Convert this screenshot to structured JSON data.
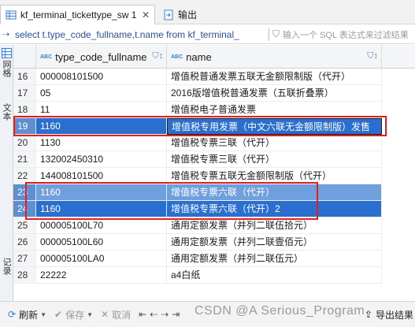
{
  "tabs": [
    {
      "label": "kf_terminal_tickettype_sw 1",
      "close": "✕",
      "active": true
    },
    {
      "label": "输出",
      "active": false
    }
  ],
  "query": {
    "sql": "select t.type_code_fullname,t.name from kf_terminal_",
    "filter_placeholder": "输入一个 SQL 表达式来过滤结果"
  },
  "side_tabs": [
    "网格",
    "文本",
    "记录"
  ],
  "columns": [
    {
      "type_tag": "ABC",
      "name": "type_code_fullname"
    },
    {
      "type_tag": "ABC",
      "name": "name"
    }
  ],
  "rows": [
    {
      "n": "16",
      "code": "000008101500",
      "name": "增值税普通发票五联无金额限制版（代开）"
    },
    {
      "n": "17",
      "code": "05",
      "name": "2016版增值税普通发票（五联折叠票）"
    },
    {
      "n": "18",
      "code": "11",
      "name": "增值税电子普通发票"
    },
    {
      "n": "19",
      "code": "1160",
      "name": "增值税专用发票（中文六联无金额限制版）发售",
      "selected": true,
      "focus": true
    },
    {
      "n": "20",
      "code": "1130",
      "name": "增值税专票三联（代开）"
    },
    {
      "n": "21",
      "code": "132002450310",
      "name": "增值税专票三联（代开）"
    },
    {
      "n": "22",
      "code": "144008101500",
      "name": "增值税专票五联无金额限制版（代开）"
    },
    {
      "n": "23",
      "code": "1160",
      "name": "增值税专票六联（代开）",
      "selected": true
    },
    {
      "n": "24",
      "code": "1160",
      "name": "增值税专票六联（代开）2",
      "selected": true,
      "focus": true
    },
    {
      "n": "25",
      "code": "000005100L70",
      "name": "通用定额发票（并列二联伍拾元）"
    },
    {
      "n": "26",
      "code": "000005100L60",
      "name": "通用定额发票（并列二联壹佰元）"
    },
    {
      "n": "27",
      "code": "000005100LA0",
      "name": "通用定额发票（并列二联伍元）"
    },
    {
      "n": "28",
      "code": "22222",
      "name": "a4白纸"
    }
  ],
  "bottom": {
    "refresh": "刷新",
    "save": "保存",
    "cancel": "取消",
    "export": "导出结果",
    "watermark": "CSDN @A Serious_Program"
  },
  "colors": {
    "selection": "#6fa0dd",
    "focus_selection": "#2a6fd0",
    "highlight_box": "#e02020",
    "sql_text": "#2a4f9c"
  }
}
